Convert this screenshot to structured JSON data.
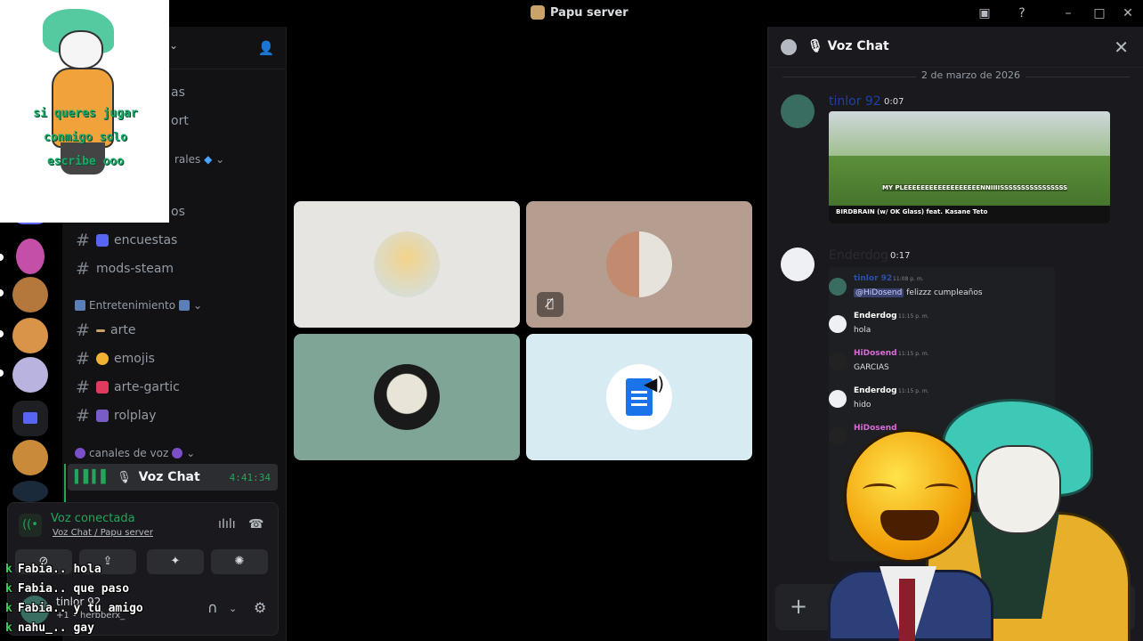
{
  "window": {
    "title": "Papu server",
    "controls": [
      "inbox-icon",
      "help-icon",
      "minimize-icon",
      "maximize-icon",
      "close-icon"
    ]
  },
  "sidebar": {
    "partial_items": [
      "as",
      "ort",
      "rales",
      "os"
    ],
    "channels": [
      {
        "name": "encuestas",
        "emoji_color": "#5865f2"
      },
      {
        "name": "mods-steam",
        "emoji_color": ""
      }
    ],
    "category_entretenimiento": "Entretenimiento",
    "channels2": [
      {
        "name": "arte",
        "emoji_color": "#c9a36a"
      },
      {
        "name": "emojis",
        "emoji_color": "#f0b232"
      },
      {
        "name": "arte-gartic",
        "emoji_color": "#e03a5f"
      },
      {
        "name": "rolplay",
        "emoji_color": "#7a5cc9"
      }
    ],
    "category_voz": "canales de voz",
    "voice_channel": {
      "name": "Voz Chat",
      "timer": "4:41:34"
    }
  },
  "voice_panel": {
    "status": "Voz conectada",
    "location": "Voz Chat / Papu server",
    "user": {
      "name": "tinlor 92",
      "sub": "+1 • herbberx_"
    }
  },
  "overlay_log": [
    {
      "user": "Fabia..",
      "msg": "hola"
    },
    {
      "user": "Fabia..",
      "msg": "que paso"
    },
    {
      "user": "Fabia..",
      "msg": "y tu amigo"
    },
    {
      "user": "nahu_..",
      "msg": "gay"
    }
  ],
  "stream_overlay": {
    "caption": [
      "si queres jugar",
      "conmigo solo",
      "escribe ooo"
    ]
  },
  "stage": {
    "tiles": [
      {
        "bg": "#e7e5e1",
        "muted": false
      },
      {
        "bg": "#b59d90",
        "muted": true
      },
      {
        "bg": "#7fa597",
        "muted": false
      },
      {
        "bg": "#d7ebf3",
        "muted": false
      }
    ]
  },
  "chat": {
    "title": "Voz Chat",
    "date": "2 de marzo de 2026",
    "messages": [
      {
        "author": "tinlor 92",
        "time": "0:07",
        "color": "#1e3fa8",
        "embed_caption": "BIRDBRAIN (w/ OK Glass) feat. Kasane Teto",
        "embed_meme": "MY PLEEEEEEEEEEEEEEEEEENNIIIISSSSSSSSSSSSSSSS"
      },
      {
        "author": "Enderdog",
        "time": "0:17",
        "color": "#2a2b30"
      }
    ],
    "screenshot_rows": [
      {
        "name": "tinlor 92",
        "time": "11:08 p. m.",
        "color": "#2c4fb0",
        "mention": "@HiDosend",
        "text": "felizzz cumpleaños"
      },
      {
        "name": "Enderdog",
        "time": "11:15 p. m.",
        "color": "#ffffff",
        "text": "hola"
      },
      {
        "name": "HiDosend",
        "time": "11:15 p. m.",
        "color": "#d86bd8",
        "text": "GARCIAS"
      },
      {
        "name": "Enderdog",
        "time": "11:15 p. m.",
        "color": "#ffffff",
        "text": "hido"
      },
      {
        "name": "HiDosend",
        "time": "",
        "color": "#d86bd8",
        "text": ""
      }
    ]
  }
}
